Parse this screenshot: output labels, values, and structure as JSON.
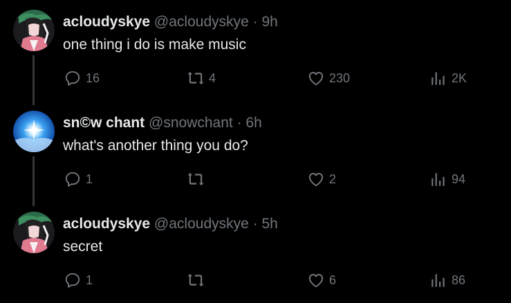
{
  "colors": {
    "background": "#000000",
    "primary_text": "#e7e9ea",
    "secondary_text": "#71767b",
    "connector": "#333639"
  },
  "posts": [
    {
      "display_name": "acloudyskye",
      "handle": "@acloudyskye",
      "separator": "·",
      "time": "9h",
      "text": "one thing i do is make music",
      "avatar": "anime-character-avatar",
      "actions": {
        "replies": "16",
        "reposts": "4",
        "likes": "230",
        "views": "2K"
      }
    },
    {
      "display_name": "sn©w chant",
      "handle": "@snowchant",
      "separator": "·",
      "time": "6h",
      "text": "what's another thing you do?",
      "avatar": "glowing-blue-star-avatar",
      "actions": {
        "replies": "1",
        "reposts": "",
        "likes": "2",
        "views": "94"
      }
    },
    {
      "display_name": "acloudyskye",
      "handle": "@acloudyskye",
      "separator": "·",
      "time": "5h",
      "text": "secret",
      "avatar": "anime-character-avatar",
      "actions": {
        "replies": "1",
        "reposts": "",
        "likes": "6",
        "views": "86"
      }
    }
  ],
  "icons": {
    "reply": "reply-icon",
    "repost": "repost-icon",
    "like": "like-icon",
    "views": "views-icon"
  }
}
